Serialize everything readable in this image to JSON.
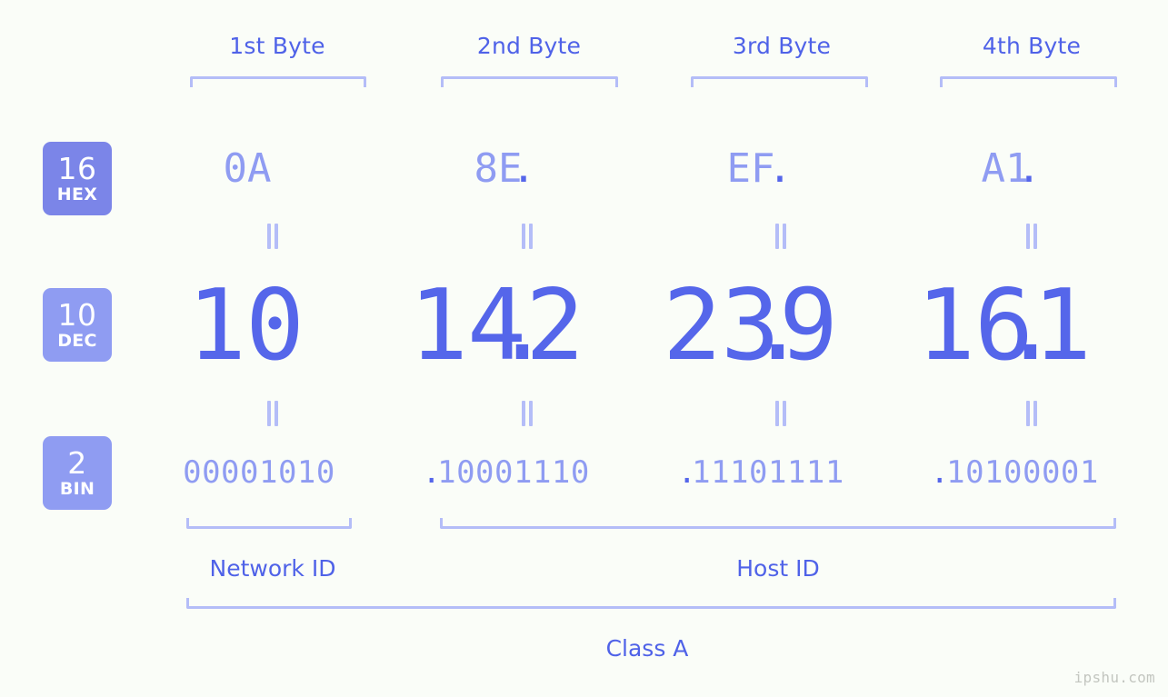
{
  "meta": {
    "background_color": "#fafdf8",
    "accent_dark": "#5566ea",
    "accent_mid": "#8f9cf2",
    "accent_light": "#b4bdf8",
    "label_color": "#4f62e8",
    "watermark_color": "#c3c6c0"
  },
  "byte_headers": [
    {
      "label": "1st Byte"
    },
    {
      "label": "2nd Byte"
    },
    {
      "label": "3rd Byte"
    },
    {
      "label": "4th Byte"
    }
  ],
  "bases": [
    {
      "num": "16",
      "abbr": "HEX",
      "color": "#7b85e8"
    },
    {
      "num": "10",
      "abbr": "DEC",
      "color": "#8f9cf2"
    },
    {
      "num": "2",
      "abbr": "BIN",
      "color": "#8f9cf2"
    }
  ],
  "rows": {
    "hex": {
      "values": [
        "0A",
        "8E",
        "EF",
        "A1"
      ],
      "separator": "."
    },
    "dec": {
      "values": [
        "10",
        "142",
        "239",
        "161"
      ],
      "separator": "."
    },
    "bin": {
      "values": [
        "00001010",
        "10001110",
        "11101111",
        "10100001"
      ],
      "separator": "."
    }
  },
  "equals_symbol": "=",
  "sections": [
    {
      "label": "Network ID"
    },
    {
      "label": "Host ID"
    }
  ],
  "class_label": "Class A",
  "watermark": "ipshu.com",
  "ip_address": "10.142.239.161"
}
